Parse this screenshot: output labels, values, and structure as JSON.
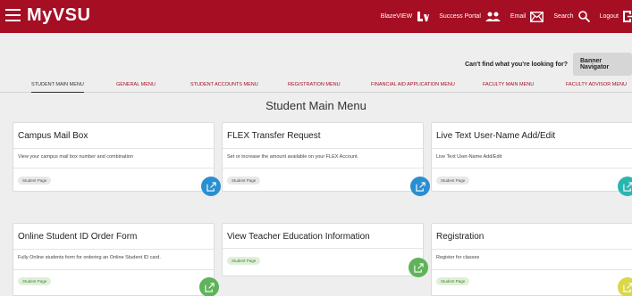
{
  "header": {
    "logo_my": "My",
    "logo_vsu": "VSU",
    "nav": [
      {
        "label": "BlazeVIEW",
        "icon": "blazeview-logo-icon"
      },
      {
        "label": "Success Portal",
        "icon": "users-icon"
      },
      {
        "label": "Email",
        "icon": "envelope-icon"
      },
      {
        "label": "Search",
        "icon": "search-icon"
      },
      {
        "label": "Logout",
        "icon": "logout-icon"
      }
    ]
  },
  "help": {
    "text": "Can't find what you're looking for?",
    "banner_button": "Banner Navigator"
  },
  "tabs": [
    {
      "label": "STUDENT MAIN MENU",
      "active": true
    },
    {
      "label": "GENERAL MENU",
      "active": false
    },
    {
      "label": "STUDENT ACCOUNTS MENU",
      "active": false
    },
    {
      "label": "REGISTRATION MENU",
      "active": false
    },
    {
      "label": "FINANCIAL AID APPLICATION MENU",
      "active": false
    },
    {
      "label": "FACULTY MAIN MENU",
      "active": false
    },
    {
      "label": "FACULTY ADVISOR MENU",
      "active": false
    }
  ],
  "page_title": "Student Main Menu",
  "cards": [
    {
      "title": "Campus Mail Box",
      "desc": "View your campus mail box number and combination",
      "chip": "Student Page",
      "color": "#2a8fd0"
    },
    {
      "title": "FLEX Transfer Request",
      "desc": "Set or increase the amount available on your FLEX Account.",
      "chip": "Student Page",
      "color": "#2a8fd0"
    },
    {
      "title": "Live Text User-Name Add/Edit",
      "desc": "Live Text User-Name Add/Edit",
      "chip": "Student Page",
      "color": "#2ab5b0"
    },
    {
      "title": "Online Student ID Order Form",
      "desc": "Fully Online students form for ordering an Online Student ID card.",
      "chip": "Student Page",
      "color": "#5fb35a"
    },
    {
      "title": "View Teacher Education Information",
      "desc": "",
      "chip": "Student Page",
      "color": "#5fb35a"
    },
    {
      "title": "Registration",
      "desc": "Register for classes",
      "chip": "Student Page",
      "color": "#d9d84a"
    }
  ],
  "colors": {
    "brand": "#a50e23"
  }
}
